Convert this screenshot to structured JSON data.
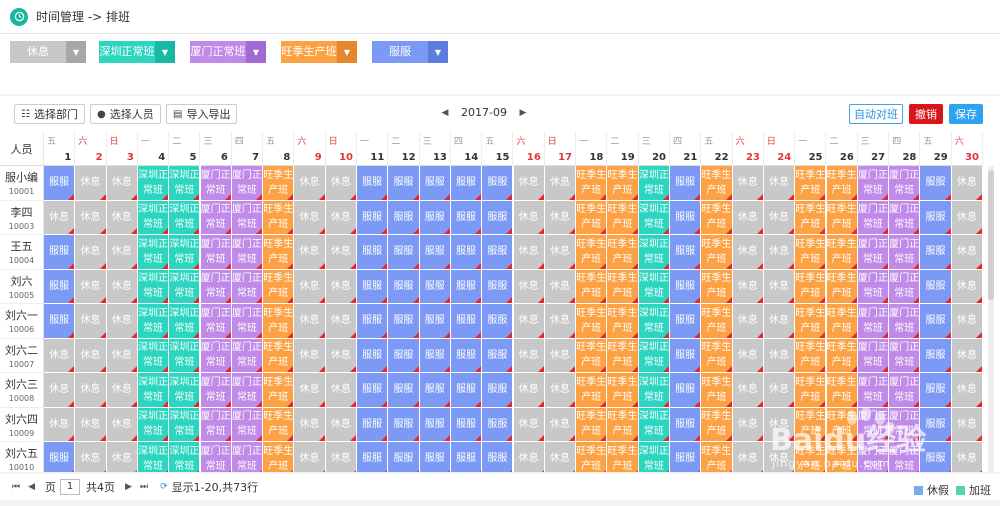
{
  "header": {
    "title": "时间管理 -> 排班"
  },
  "shift_types": [
    {
      "label": "休息",
      "color": "#c8c8c8"
    },
    {
      "label": "深圳正常班",
      "color": "#2cd5c0"
    },
    {
      "label": "厦门正常班",
      "color": "#c08ae8"
    },
    {
      "label": "旺季生产班",
      "color": "#fca245"
    },
    {
      "label": "服服",
      "color": "#7b99f5"
    }
  ],
  "toolbar": {
    "select_dept": "选择部门",
    "select_person": "选择人员",
    "import_export": "导入导出",
    "month": "2017-09",
    "auto_shift": "自动对班",
    "undo": "撤销",
    "save": "保存"
  },
  "grid": {
    "person_header": "人员",
    "days": [
      {
        "d": "1",
        "w": "五"
      },
      {
        "d": "2",
        "w": "六"
      },
      {
        "d": "3",
        "w": "日"
      },
      {
        "d": "4",
        "w": "一"
      },
      {
        "d": "5",
        "w": "二"
      },
      {
        "d": "6",
        "w": "三"
      },
      {
        "d": "7",
        "w": "四"
      },
      {
        "d": "8",
        "w": "五"
      },
      {
        "d": "9",
        "w": "六"
      },
      {
        "d": "10",
        "w": "日"
      },
      {
        "d": "11",
        "w": "一"
      },
      {
        "d": "12",
        "w": "二"
      },
      {
        "d": "13",
        "w": "三"
      },
      {
        "d": "14",
        "w": "四"
      },
      {
        "d": "15",
        "w": "五"
      },
      {
        "d": "16",
        "w": "六"
      },
      {
        "d": "17",
        "w": "日"
      },
      {
        "d": "18",
        "w": "一"
      },
      {
        "d": "19",
        "w": "二"
      },
      {
        "d": "20",
        "w": "三"
      },
      {
        "d": "21",
        "w": "四"
      },
      {
        "d": "22",
        "w": "五"
      },
      {
        "d": "23",
        "w": "六"
      },
      {
        "d": "24",
        "w": "日"
      },
      {
        "d": "25",
        "w": "一"
      },
      {
        "d": "26",
        "w": "二"
      },
      {
        "d": "27",
        "w": "三"
      },
      {
        "d": "28",
        "w": "四"
      },
      {
        "d": "29",
        "w": "五"
      },
      {
        "d": "30",
        "w": "六"
      }
    ],
    "weekend_days": [
      2,
      3,
      9,
      10,
      16,
      17,
      23,
      24,
      30
    ],
    "employees": [
      {
        "name": "服小编",
        "id": "10001"
      },
      {
        "name": "李四",
        "id": "10003"
      },
      {
        "name": "王五",
        "id": "10004"
      },
      {
        "name": "刘六",
        "id": "10005"
      },
      {
        "name": "刘六一",
        "id": "10006"
      },
      {
        "name": "刘六二",
        "id": "10007"
      },
      {
        "name": "刘六三",
        "id": "10008"
      },
      {
        "name": "刘六四",
        "id": "10009"
      },
      {
        "name": "刘六五",
        "id": "10010"
      }
    ],
    "schedule_rows": [
      [
        "服服",
        "休息",
        "休息",
        "深圳正常班",
        "深圳正常班",
        "厦门正常班",
        "厦门正常班",
        "旺季生产班",
        "休息",
        "休息",
        "服服",
        "服服",
        "服服",
        "服服",
        "服服",
        "休息",
        "休息",
        "旺季生产班",
        "旺季生产班",
        "深圳正常班",
        "服服",
        "旺季生产班",
        "休息",
        "休息",
        "旺季生产班",
        "旺季生产班",
        "厦门正常班",
        "厦门正常班",
        "服服",
        "休息"
      ],
      [
        "休息",
        "休息",
        "休息",
        "深圳正常班",
        "深圳正常班",
        "厦门正常班",
        "厦门正常班",
        "旺季生产班",
        "休息",
        "休息",
        "服服",
        "服服",
        "服服",
        "服服",
        "服服",
        "休息",
        "休息",
        "旺季生产班",
        "旺季生产班",
        "深圳正常班",
        "服服",
        "旺季生产班",
        "休息",
        "休息",
        "旺季生产班",
        "旺季生产班",
        "厦门正常班",
        "厦门正常班",
        "服服",
        "休息"
      ],
      [
        "服服",
        "休息",
        "休息",
        "深圳正常班",
        "深圳正常班",
        "厦门正常班",
        "厦门正常班",
        "旺季生产班",
        "休息",
        "休息",
        "服服",
        "服服",
        "服服",
        "服服",
        "服服",
        "休息",
        "休息",
        "旺季生产班",
        "旺季生产班",
        "深圳正常班",
        "服服",
        "旺季生产班",
        "休息",
        "休息",
        "旺季生产班",
        "旺季生产班",
        "厦门正常班",
        "厦门正常班",
        "服服",
        "休息"
      ],
      [
        "服服",
        "休息",
        "休息",
        "深圳正常班",
        "深圳正常班",
        "厦门正常班",
        "厦门正常班",
        "旺季生产班",
        "休息",
        "休息",
        "服服",
        "服服",
        "服服",
        "服服",
        "服服",
        "休息",
        "休息",
        "旺季生产班",
        "旺季生产班",
        "深圳正常班",
        "服服",
        "旺季生产班",
        "休息",
        "休息",
        "旺季生产班",
        "旺季生产班",
        "厦门正常班",
        "厦门正常班",
        "服服",
        "休息"
      ],
      [
        "服服",
        "休息",
        "休息",
        "深圳正常班",
        "深圳正常班",
        "厦门正常班",
        "厦门正常班",
        "旺季生产班",
        "休息",
        "休息",
        "服服",
        "服服",
        "服服",
        "服服",
        "服服",
        "休息",
        "休息",
        "旺季生产班",
        "旺季生产班",
        "深圳正常班",
        "服服",
        "旺季生产班",
        "休息",
        "休息",
        "旺季生产班",
        "旺季生产班",
        "厦门正常班",
        "厦门正常班",
        "服服",
        "休息"
      ],
      [
        "休息",
        "休息",
        "休息",
        "深圳正常班",
        "深圳正常班",
        "厦门正常班",
        "厦门正常班",
        "旺季生产班",
        "休息",
        "休息",
        "服服",
        "服服",
        "服服",
        "服服",
        "服服",
        "休息",
        "休息",
        "旺季生产班",
        "旺季生产班",
        "深圳正常班",
        "服服",
        "旺季生产班",
        "休息",
        "休息",
        "旺季生产班",
        "旺季生产班",
        "厦门正常班",
        "厦门正常班",
        "服服",
        "休息"
      ],
      [
        "休息",
        "休息",
        "休息",
        "深圳正常班",
        "深圳正常班",
        "厦门正常班",
        "厦门正常班",
        "旺季生产班",
        "休息",
        "休息",
        "服服",
        "服服",
        "服服",
        "服服",
        "服服",
        "休息",
        "休息",
        "旺季生产班",
        "旺季生产班",
        "深圳正常班",
        "服服",
        "旺季生产班",
        "休息",
        "休息",
        "旺季生产班",
        "旺季生产班",
        "厦门正常班",
        "厦门正常班",
        "服服",
        "休息"
      ],
      [
        "休息",
        "休息",
        "休息",
        "深圳正常班",
        "深圳正常班",
        "厦门正常班",
        "厦门正常班",
        "旺季生产班",
        "休息",
        "休息",
        "服服",
        "服服",
        "服服",
        "服服",
        "服服",
        "休息",
        "休息",
        "旺季生产班",
        "旺季生产班",
        "深圳正常班",
        "服服",
        "旺季生产班",
        "休息",
        "休息",
        "旺季生产班",
        "旺季生产班",
        "厦门正常班",
        "厦门正常班",
        "服服",
        "休息"
      ],
      [
        "服服",
        "休息",
        "休息",
        "深圳正常班",
        "深圳正常班",
        "厦门正常班",
        "厦门正常班",
        "旺季生产班",
        "休息",
        "休息",
        "服服",
        "服服",
        "服服",
        "服服",
        "服服",
        "休息",
        "休息",
        "旺季生产班",
        "旺季生产班",
        "深圳正常班",
        "服服",
        "旺季生产班",
        "休息",
        "休息",
        "旺季生产班",
        "旺季生产班",
        "厦门正常班",
        "厦门正常班",
        "服服",
        "休息"
      ]
    ]
  },
  "footer": {
    "page_label": "页",
    "page_value": "1",
    "total_pages": "共4页",
    "display_info": "显示1-20,共73行",
    "legend_leave": "休假",
    "legend_leave_color": "#7aaaf0",
    "legend_overtime": "加班",
    "legend_overtime_color": "#4fd8a6"
  },
  "watermark": {
    "text": "Baidu经验",
    "sub": "jingyan.baidu.com"
  }
}
